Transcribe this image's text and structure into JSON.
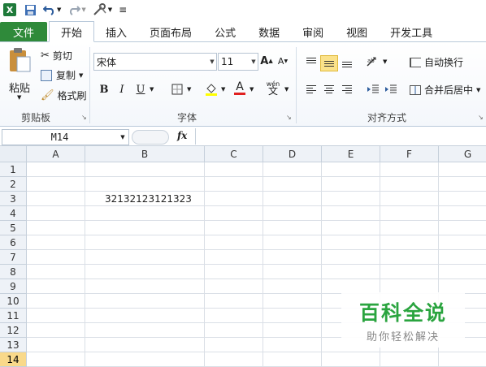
{
  "qat": {
    "menu_glyph": "≡"
  },
  "tabs": [
    "文件",
    "开始",
    "插入",
    "页面布局",
    "公式",
    "数据",
    "审阅",
    "视图",
    "开发工具"
  ],
  "clipboard": {
    "paste": "粘贴",
    "cut": "剪切",
    "copy": "复制",
    "format_painter": "格式刷",
    "group": "剪贴板"
  },
  "font": {
    "name": "宋体",
    "size": "11",
    "group": "字体",
    "bold": "B",
    "italic": "I",
    "underline": "U",
    "grow": "A",
    "shrink": "A",
    "wen": "wén",
    "wen_char": "文"
  },
  "alignment": {
    "wrap": "自动换行",
    "merge": "合并后居中",
    "group": "对齐方式"
  },
  "formula_bar": {
    "cell_ref": "M14",
    "fx": "fx",
    "value": ""
  },
  "columns": [
    "A",
    "B",
    "C",
    "D",
    "E",
    "F",
    "G"
  ],
  "rows": [
    "1",
    "2",
    "3",
    "4",
    "5",
    "6",
    "7",
    "8",
    "9",
    "10",
    "11",
    "12",
    "13",
    "14"
  ],
  "cells": {
    "B3": "32132123121323"
  },
  "selected_row": "14",
  "watermark": {
    "title": "百科全说",
    "subtitle": "助你轻松解决"
  }
}
